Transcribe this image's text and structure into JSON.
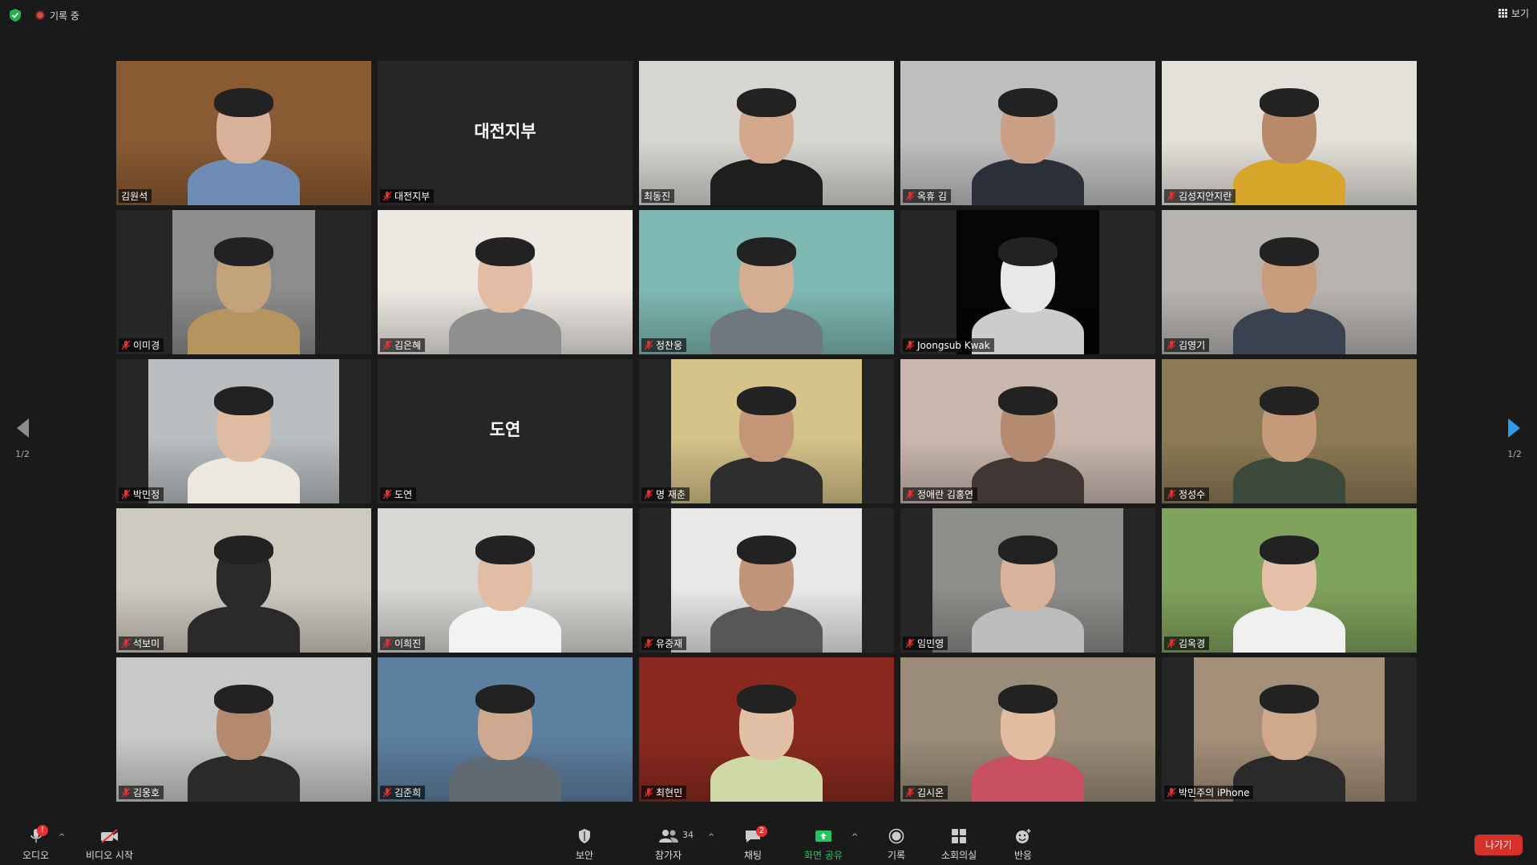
{
  "status": {
    "recording": "기록 중",
    "view": "보기"
  },
  "tiles": [
    {
      "name": "김원석",
      "type": "video",
      "bg": "#8a5a33",
      "vleft": 0,
      "vwidth": 318,
      "muted": false,
      "active": true,
      "skin": "#d9b09a",
      "shirt": "#6f8db4"
    },
    {
      "name": "대전지부",
      "type": "name",
      "bigname": "대전지부",
      "muted": true
    },
    {
      "name": "최동진",
      "type": "video",
      "bg": "#d8d6d0",
      "vleft": 0,
      "vwidth": 318,
      "muted": false,
      "skin": "#d2a98c",
      "shirt": "#1e1e1e"
    },
    {
      "name": "옥휴 김",
      "type": "video",
      "bg": "#bfbfbf",
      "vleft": 0,
      "vwidth": 318,
      "muted": true,
      "skin": "#c9a086",
      "shirt": "#2b2f3a"
    },
    {
      "name": "김성지안지란",
      "type": "video",
      "bg": "#e4e1da",
      "vleft": 0,
      "vwidth": 318,
      "muted": true,
      "skin": "#b98a6a",
      "shirt": "#d7a52a"
    },
    {
      "name": "이미경",
      "type": "video",
      "bg": "#8c8c8c",
      "vleft": 70,
      "vwidth": 178,
      "muted": true,
      "skin": "#c3a37b",
      "shirt": "#b5945f"
    },
    {
      "name": "김은혜",
      "type": "video",
      "bg": "#ede8e2",
      "vleft": 0,
      "vwidth": 318,
      "muted": true,
      "skin": "#e2bda4",
      "shirt": "#8f8f8f"
    },
    {
      "name": "정찬웅",
      "type": "video",
      "bg": "#7fb8b3",
      "vleft": 0,
      "vwidth": 318,
      "muted": true,
      "skin": "#d4ad92",
      "shirt": "#6f7880"
    },
    {
      "name": "Joongsub Kwak",
      "type": "video",
      "bg": "#050505",
      "vleft": 70,
      "vwidth": 178,
      "muted": true,
      "skin": "#e8e8e8",
      "shirt": "#cccccc"
    },
    {
      "name": "김영기",
      "type": "video",
      "bg": "#b7b4b0",
      "vleft": 0,
      "vwidth": 318,
      "muted": true,
      "skin": "#c79c7d",
      "shirt": "#3a4250"
    },
    {
      "name": "박민정",
      "type": "video",
      "bg": "#b9bdc0",
      "vleft": 40,
      "vwidth": 238,
      "muted": true,
      "skin": "#e0bca3",
      "shirt": "#ece8e0"
    },
    {
      "name": "도연",
      "type": "name",
      "bigname": "도연",
      "muted": true
    },
    {
      "name": "명 재춘",
      "type": "video",
      "bg": "#d6c38a",
      "vleft": 40,
      "vwidth": 238,
      "muted": true,
      "skin": "#c29677",
      "shirt": "#2e2e2e"
    },
    {
      "name": "정애란 김홍연",
      "type": "video",
      "bg": "#c9b7ae",
      "vleft": 0,
      "vwidth": 318,
      "muted": true,
      "skin": "#b48a70",
      "shirt": "#403634"
    },
    {
      "name": "정성수",
      "type": "video",
      "bg": "#8c7a55",
      "vleft": 0,
      "vwidth": 318,
      "muted": true,
      "skin": "#c49a7b",
      "shirt": "#3b4a3a"
    },
    {
      "name": "석보미",
      "type": "video",
      "bg": "#cfcac0",
      "vleft": 0,
      "vwidth": 318,
      "muted": true,
      "skin": "#2a2a2a",
      "shirt": "#2a2a2a"
    },
    {
      "name": "이희진",
      "type": "video",
      "bg": "#d9d7d3",
      "vleft": 0,
      "vwidth": 318,
      "muted": true,
      "skin": "#e1bda3",
      "shirt": "#f2f2f2"
    },
    {
      "name": "유중재",
      "type": "video",
      "bg": "#e8e8e6",
      "vleft": 40,
      "vwidth": 238,
      "muted": true,
      "skin": "#c09478",
      "shirt": "#575757"
    },
    {
      "name": "임민영",
      "type": "video",
      "bg": "#8d8d8a",
      "vleft": 40,
      "vwidth": 238,
      "muted": true,
      "skin": "#d8b39a",
      "shirt": "#bdbdbd"
    },
    {
      "name": "김옥경",
      "type": "video",
      "bg": "#7fa25c",
      "vleft": 0,
      "vwidth": 318,
      "muted": true,
      "skin": "#e4c0a8",
      "shirt": "#f0f0f0"
    },
    {
      "name": "김웅호",
      "type": "video",
      "bg": "#c8c9c6",
      "vleft": 0,
      "vwidth": 318,
      "muted": true,
      "skin": "#b48a6f",
      "shirt": "#2a2a2a"
    },
    {
      "name": "김준희",
      "type": "video",
      "bg": "#5d7fa0",
      "vleft": 0,
      "vwidth": 318,
      "muted": true,
      "skin": "#cfa98f",
      "shirt": "#5f6a73"
    },
    {
      "name": "최현민",
      "type": "video",
      "bg": "#8a2a1f",
      "vleft": 0,
      "vwidth": 318,
      "muted": true,
      "skin": "#e2c0a5",
      "shirt": "#cfd9a8"
    },
    {
      "name": "김시온",
      "type": "video",
      "bg": "#9a8c78",
      "vleft": 0,
      "vwidth": 318,
      "muted": true,
      "skin": "#e1bca1",
      "shirt": "#c9505f"
    },
    {
      "name": "박민주의 iPhone",
      "type": "video",
      "bg": "#a48f78",
      "vleft": 40,
      "vwidth": 238,
      "muted": true,
      "skin": "#cfa88d",
      "shirt": "#2b2b2b"
    }
  ],
  "nav": {
    "page": "1/2"
  },
  "toolbar": {
    "audio": "오디오",
    "audio_badge": "!",
    "video": "비디오 시작",
    "security": "보안",
    "participants": "참가자",
    "participants_count": "34",
    "chat": "채팅",
    "chat_badge": "2",
    "share": "화면 공유",
    "record": "기록",
    "breakout": "소회의실",
    "reactions": "반응",
    "leave": "나가기"
  },
  "colors": {
    "share_green": "#22c55e",
    "active_border": "#e6e36b",
    "leave_red": "#d4312b"
  }
}
